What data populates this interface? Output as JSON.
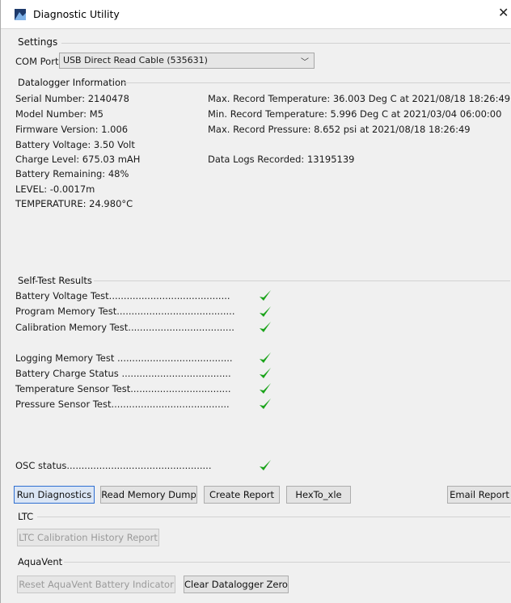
{
  "window": {
    "title": "Diagnostic Utility",
    "close_glyph": "✕"
  },
  "settings": {
    "title": "Settings",
    "com_port_label": "COM Port:",
    "com_port_value": "USB Direct Read Cable (535631)"
  },
  "datalogger": {
    "title": "Datalogger Information",
    "left": [
      "Serial Number: 2140478",
      "Model Number: M5",
      "Firmware Version: 1.006",
      "Battery Voltage: 3.50 Volt",
      "Charge Level: 675.03 mAH",
      "Battery Remaining: 48%",
      "LEVEL: -0.0017m",
      "TEMPERATURE: 24.980°C"
    ],
    "right": [
      "Max. Record Temperature: 36.003 Deg C at 2021/08/18 18:26:49",
      "Min. Record Temperature: 5.996 Deg C at 2021/03/04 06:00:00",
      "Max. Record Pressure: 8.652 psi at 2021/08/18 18:26:49",
      "",
      "Data Logs Recorded: 13195139"
    ]
  },
  "selftest": {
    "title": "Self-Test Results",
    "tests": [
      "Battery Voltage Test.........................................",
      "Program Memory Test........................................",
      "Calibration Memory Test....................................",
      "Logging Memory Test .......................................",
      "Battery Charge Status .....................................",
      "Temperature Sensor Test..................................",
      "Pressure Sensor Test........................................",
      "OSC status................................................."
    ],
    "check_color": "#1aa31a"
  },
  "actions": {
    "run_diagnostics": "Run Diagnostics",
    "read_memory_dump": "Read Memory Dump",
    "create_report": "Create Report",
    "hexto_xle": "HexTo_xle",
    "email_report": "Email Report"
  },
  "ltc": {
    "title": "LTC",
    "history_report": "LTC Calibration History Report"
  },
  "aquavent": {
    "title": "AquaVent",
    "reset_battery": "Reset AquaVent Battery Indicator",
    "clear_zero": "Clear Datalogger Zero"
  }
}
